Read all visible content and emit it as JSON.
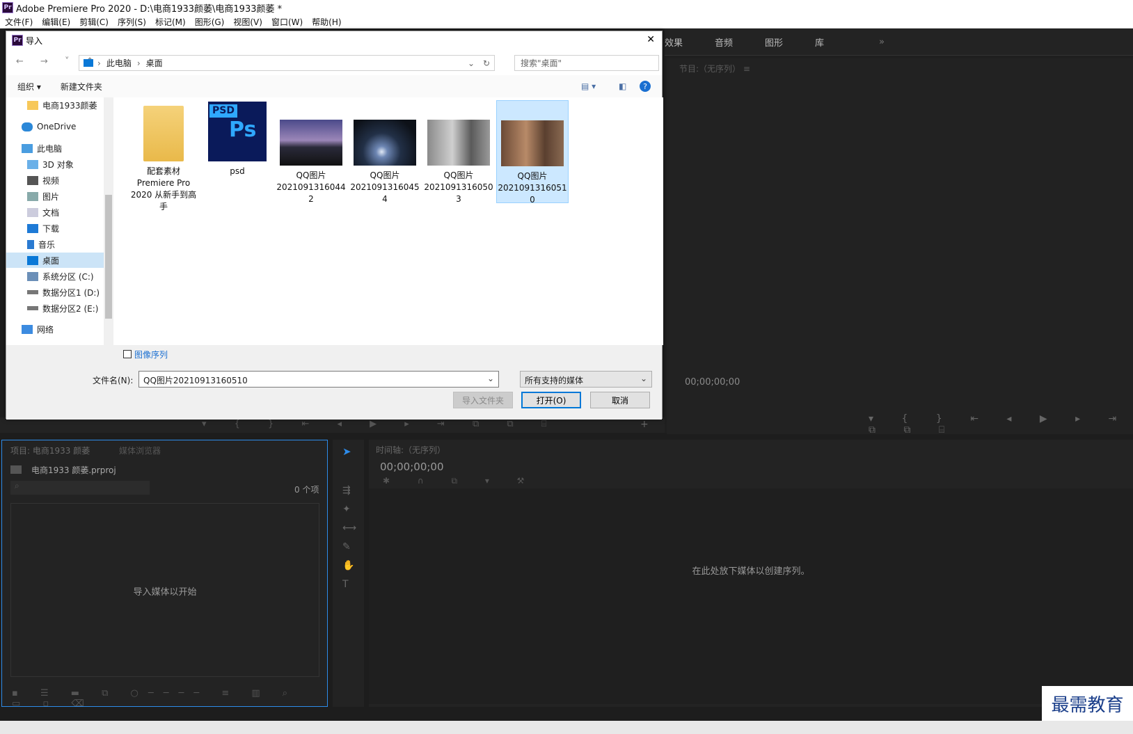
{
  "window": {
    "title": "Adobe Premiere Pro 2020 - D:\\电商1933颜萎\\电商1933颜萎 *",
    "logo": "Pr"
  },
  "menu": [
    "文件(F)",
    "编辑(E)",
    "剪辑(C)",
    "序列(S)",
    "标记(M)",
    "图形(G)",
    "视图(V)",
    "窗口(W)",
    "帮助(H)"
  ],
  "panel_tabs": [
    "效果",
    "音频",
    "图形",
    "库"
  ],
  "program": {
    "title": "节目:（无序列）",
    "menu_icon": "≡",
    "timecode": "00;00;00;00"
  },
  "project": {
    "tab1": "项目: 电商1933 颜萎",
    "tab2": "媒体浏览器",
    "file": "电商1933 颜萎.prproj",
    "count": "0 个项",
    "empty": "导入媒体以开始"
  },
  "timeline": {
    "title": "时间轴:（无序列）",
    "timecode": "00;00;00;00",
    "empty": "在此处放下媒体以创建序列。"
  },
  "watermark": "最需教育",
  "dialog": {
    "title": "导入",
    "close": "✕",
    "breadcrumb": [
      "此电脑",
      "桌面"
    ],
    "search_placeholder": "搜索\"桌面\"",
    "organize": "组织 ▾",
    "new_folder": "新建文件夹",
    "nav": [
      "电商1933颜萎",
      "OneDrive",
      "此电脑",
      "3D 对象",
      "视频",
      "图片",
      "文档",
      "下载",
      "音乐",
      "桌面",
      "系统分区 (C:)",
      "数据分区1 (D:)",
      "数据分区2 (E:)",
      "网络"
    ],
    "files": [
      {
        "name": "配套素材\nPremiere Pro\n2020 从新手到高\n手",
        "kind": "folder"
      },
      {
        "name": "psd",
        "kind": "psd"
      },
      {
        "name": "QQ图片\n2021091316044\n2",
        "kind": "photo1"
      },
      {
        "name": "QQ图片\n2021091316045\n4",
        "kind": "photo2"
      },
      {
        "name": "QQ图片\n2021091316050\n3",
        "kind": "photo3"
      },
      {
        "name": "QQ图片\n2021091316051\n0",
        "kind": "photo4"
      }
    ],
    "image_sequence": "图像序列",
    "filename_label": "文件名(N):",
    "filename_value": "QQ图片20210913160510",
    "filetype": "所有支持的媒体",
    "import_folder": "导入文件夹",
    "open": "打开(O)",
    "cancel": "取消"
  }
}
